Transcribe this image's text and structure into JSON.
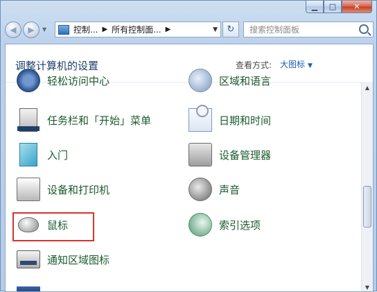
{
  "window": {
    "minimize_icon": "minimize-icon",
    "maximize_icon": "maximize-icon",
    "close_icon": "close-icon"
  },
  "nav": {
    "breadcrumb": [
      "控制...",
      "所有控制面..."
    ],
    "search_placeholder": "搜索控制面板"
  },
  "header": {
    "title": "调整计算机的设置",
    "view_label": "查看方式:",
    "view_value": "大图标"
  },
  "items": {
    "ease_of_access": "轻松访问中心",
    "region_language": "区域和语言",
    "taskbar_start": "任务栏和「开始」菜单",
    "date_time": "日期和时间",
    "getting_started": "入门",
    "device_manager": "设备管理器",
    "devices_printers": "设备和打印机",
    "sound": "声音",
    "mouse": "鼠标",
    "indexing_options": "索引选项",
    "notification_icons": "通知区域图标"
  },
  "colors": {
    "link_green": "#1b5a2c",
    "highlight_red": "#d6332b",
    "view_blue": "#1b5fb4"
  }
}
